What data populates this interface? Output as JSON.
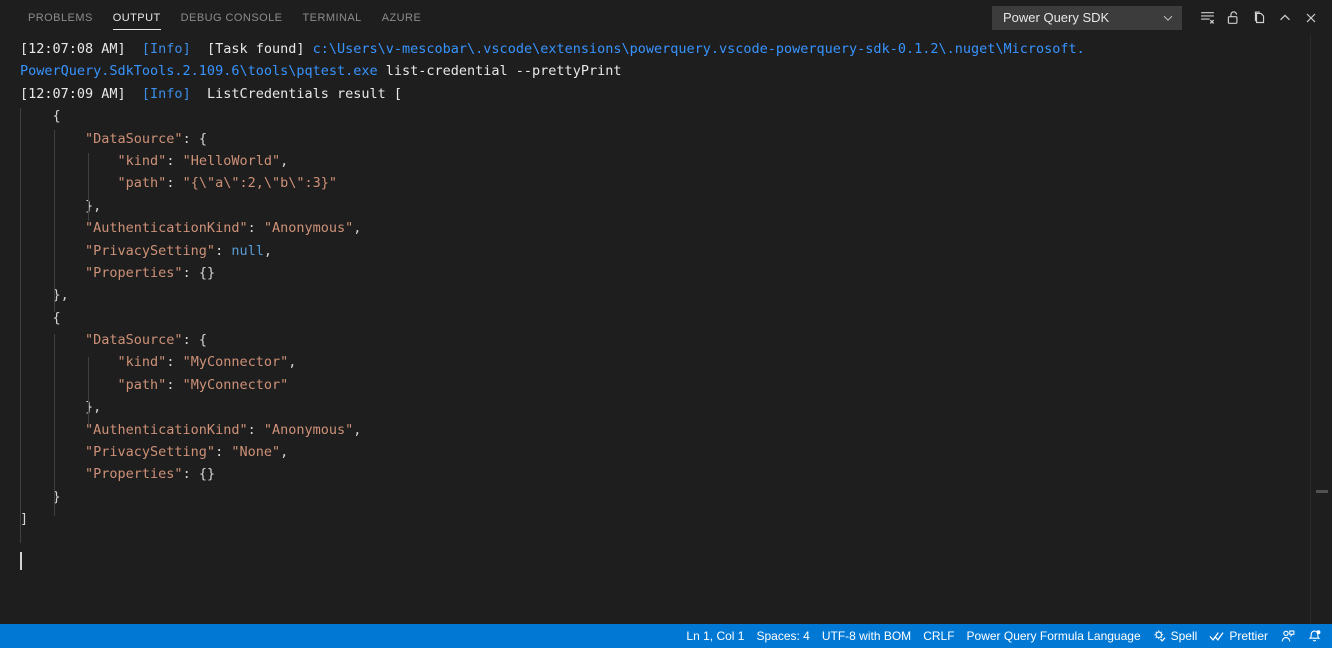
{
  "panel": {
    "tabs": [
      {
        "label": "PROBLEMS",
        "active": false
      },
      {
        "label": "OUTPUT",
        "active": true
      },
      {
        "label": "DEBUG CONSOLE",
        "active": false
      },
      {
        "label": "TERMINAL",
        "active": false
      },
      {
        "label": "AZURE",
        "active": false
      }
    ],
    "channel_select": {
      "value": "Power Query SDK",
      "icon": "chevron-down-icon"
    },
    "actions": [
      {
        "name": "clear-output-icon",
        "title": "Clear Output"
      },
      {
        "name": "unlock-scroll-icon",
        "title": "Turn Auto Scrolling Off"
      },
      {
        "name": "open-in-editor-icon",
        "title": "Open Output in Editor"
      },
      {
        "name": "chevron-up-icon",
        "title": "Maximize Panel Size"
      },
      {
        "name": "close-icon",
        "title": "Close Panel"
      }
    ]
  },
  "output": {
    "lines": [
      {
        "id": "l1",
        "indent": 0,
        "tokens": [
          {
            "c": "t-time",
            "t": "[12:07:08 AM] "
          },
          {
            "c": "t-info",
            "t": " [Info]"
          },
          {
            "c": "t-plain",
            "t": "  [Task found] "
          },
          {
            "c": "t-link",
            "t": "c:\\Users\\v-mescobar\\.vscode\\extensions\\powerquery.vscode-powerquery-sdk-0.1.2\\.nuget\\Microsoft."
          }
        ]
      },
      {
        "id": "l2",
        "indent": 0,
        "tokens": [
          {
            "c": "t-link",
            "t": "PowerQuery.SdkTools.2.109.6\\tools\\pqtest.exe"
          },
          {
            "c": "t-plain",
            "t": " list-credential --prettyPrint"
          }
        ]
      },
      {
        "id": "l3",
        "indent": 0,
        "tokens": [
          {
            "c": "t-time",
            "t": "[12:07:09 AM] "
          },
          {
            "c": "t-info",
            "t": " [Info]"
          },
          {
            "c": "t-plain",
            "t": "  ListCredentials result ["
          }
        ]
      },
      {
        "id": "l4",
        "indent": 0,
        "tokens": [
          {
            "c": "t-punct",
            "t": "    {"
          }
        ]
      },
      {
        "id": "l5",
        "indent": 0,
        "tokens": [
          {
            "c": "t-key",
            "t": "        \"DataSource\""
          },
          {
            "c": "t-punct",
            "t": ": {"
          }
        ]
      },
      {
        "id": "l6",
        "indent": 0,
        "tokens": [
          {
            "c": "t-key",
            "t": "            \"kind\""
          },
          {
            "c": "t-punct",
            "t": ": "
          },
          {
            "c": "t-str",
            "t": "\"HelloWorld\""
          },
          {
            "c": "t-punct",
            "t": ","
          }
        ]
      },
      {
        "id": "l7",
        "indent": 0,
        "tokens": [
          {
            "c": "t-key",
            "t": "            \"path\""
          },
          {
            "c": "t-punct",
            "t": ": "
          },
          {
            "c": "t-str",
            "t": "\"{\\\"a\\\":2,\\\"b\\\":3}\""
          }
        ]
      },
      {
        "id": "l8",
        "indent": 0,
        "tokens": [
          {
            "c": "t-punct",
            "t": "        },"
          }
        ]
      },
      {
        "id": "l9",
        "indent": 0,
        "tokens": [
          {
            "c": "t-key",
            "t": "        \"AuthenticationKind\""
          },
          {
            "c": "t-punct",
            "t": ": "
          },
          {
            "c": "t-str",
            "t": "\"Anonymous\""
          },
          {
            "c": "t-punct",
            "t": ","
          }
        ]
      },
      {
        "id": "l10",
        "indent": 0,
        "tokens": [
          {
            "c": "t-key",
            "t": "        \"PrivacySetting\""
          },
          {
            "c": "t-punct",
            "t": ": "
          },
          {
            "c": "t-null",
            "t": "null"
          },
          {
            "c": "t-punct",
            "t": ","
          }
        ]
      },
      {
        "id": "l11",
        "indent": 0,
        "tokens": [
          {
            "c": "t-key",
            "t": "        \"Properties\""
          },
          {
            "c": "t-punct",
            "t": ": {}"
          }
        ]
      },
      {
        "id": "l12",
        "indent": 0,
        "tokens": [
          {
            "c": "t-punct",
            "t": "    },"
          }
        ]
      },
      {
        "id": "l13",
        "indent": 0,
        "tokens": [
          {
            "c": "t-punct",
            "t": "    {"
          }
        ]
      },
      {
        "id": "l14",
        "indent": 0,
        "tokens": [
          {
            "c": "t-key",
            "t": "        \"DataSource\""
          },
          {
            "c": "t-punct",
            "t": ": {"
          }
        ]
      },
      {
        "id": "l15",
        "indent": 0,
        "tokens": [
          {
            "c": "t-key",
            "t": "            \"kind\""
          },
          {
            "c": "t-punct",
            "t": ": "
          },
          {
            "c": "t-str",
            "t": "\"MyConnector\""
          },
          {
            "c": "t-punct",
            "t": ","
          }
        ]
      },
      {
        "id": "l16",
        "indent": 0,
        "tokens": [
          {
            "c": "t-key",
            "t": "            \"path\""
          },
          {
            "c": "t-punct",
            "t": ": "
          },
          {
            "c": "t-str",
            "t": "\"MyConnector\""
          }
        ]
      },
      {
        "id": "l17",
        "indent": 0,
        "tokens": [
          {
            "c": "t-punct",
            "t": "        },"
          }
        ]
      },
      {
        "id": "l18",
        "indent": 0,
        "tokens": [
          {
            "c": "t-key",
            "t": "        \"AuthenticationKind\""
          },
          {
            "c": "t-punct",
            "t": ": "
          },
          {
            "c": "t-str",
            "t": "\"Anonymous\""
          },
          {
            "c": "t-punct",
            "t": ","
          }
        ]
      },
      {
        "id": "l19",
        "indent": 0,
        "tokens": [
          {
            "c": "t-key",
            "t": "        \"PrivacySetting\""
          },
          {
            "c": "t-punct",
            "t": ": "
          },
          {
            "c": "t-str",
            "t": "\"None\""
          },
          {
            "c": "t-punct",
            "t": ","
          }
        ]
      },
      {
        "id": "l20",
        "indent": 0,
        "tokens": [
          {
            "c": "t-key",
            "t": "        \"Properties\""
          },
          {
            "c": "t-punct",
            "t": ": {}"
          }
        ]
      },
      {
        "id": "l21",
        "indent": 0,
        "tokens": [
          {
            "c": "t-punct",
            "t": "    }"
          }
        ]
      },
      {
        "id": "l22",
        "indent": 0,
        "tokens": [
          {
            "c": "t-punct",
            "t": "]"
          }
        ]
      },
      {
        "id": "l23",
        "indent": 0,
        "tokens": []
      }
    ]
  },
  "statusbar": {
    "items": [
      {
        "name": "status-cursor-position",
        "label": "Ln 1, Col 1",
        "icon": null
      },
      {
        "name": "status-indentation",
        "label": "Spaces: 4",
        "icon": null
      },
      {
        "name": "status-encoding",
        "label": "UTF-8 with BOM",
        "icon": null
      },
      {
        "name": "status-eol",
        "label": "CRLF",
        "icon": null
      },
      {
        "name": "status-language-mode",
        "label": "Power Query Formula Language",
        "icon": null
      },
      {
        "name": "status-spell-checker",
        "label": "Spell",
        "icon": "spell-gear-icon"
      },
      {
        "name": "status-prettier",
        "label": "Prettier",
        "icon": "double-check-icon"
      },
      {
        "name": "status-feedback",
        "label": "",
        "icon": "feedback-person-icon"
      },
      {
        "name": "status-notifications",
        "label": "",
        "icon": "bell-icon"
      }
    ]
  },
  "colors": {
    "background": "#1e1e1e",
    "statusbar": "#0078d4",
    "accent_link": "#3794ff",
    "info": "#3b8eea",
    "string": "#ce9178",
    "keyword": "#569cd6"
  }
}
